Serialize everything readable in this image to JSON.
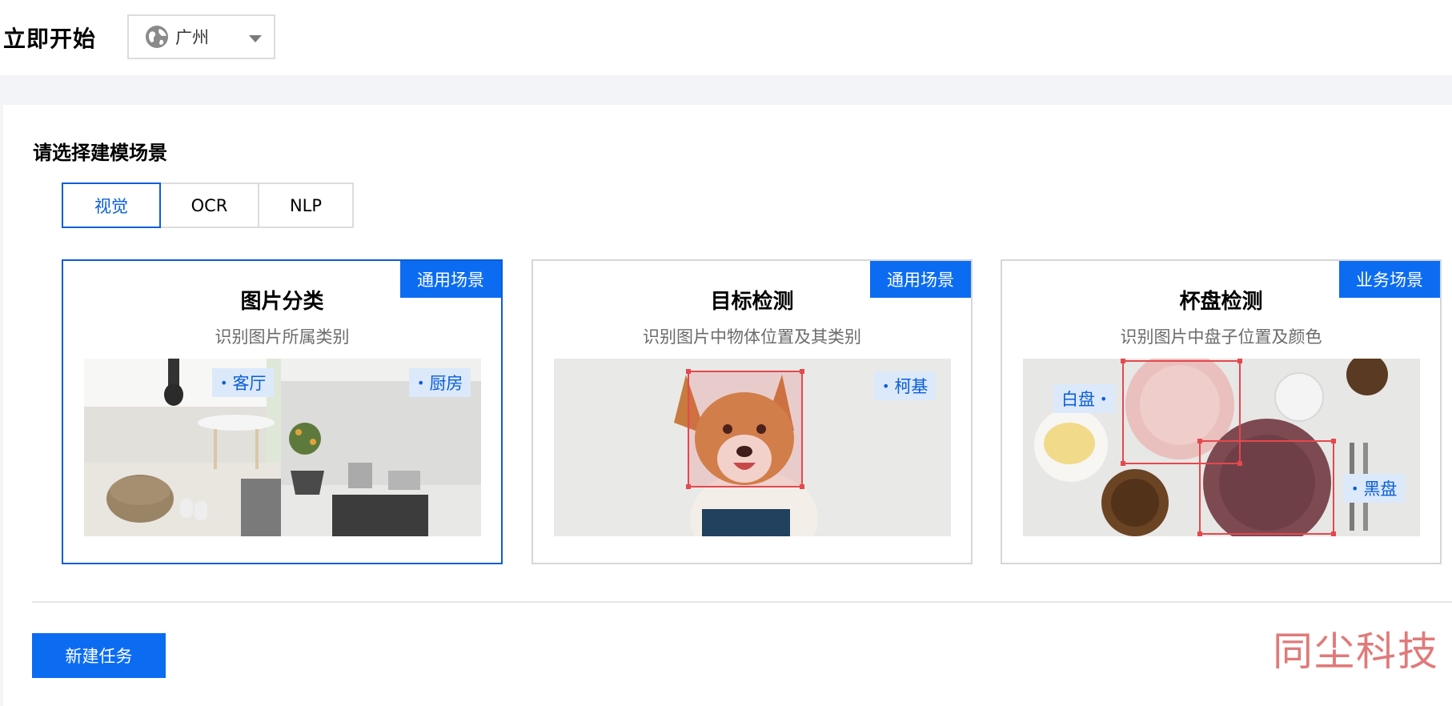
{
  "header": {
    "title": "立即开始",
    "region_select": {
      "value": "广州",
      "icon": "globe-icon"
    }
  },
  "main": {
    "section_title": "请选择建模场景",
    "tabs": [
      {
        "label": "视觉",
        "active": true
      },
      {
        "label": "OCR",
        "active": false
      },
      {
        "label": "NLP",
        "active": false
      }
    ],
    "cards": [
      {
        "title": "图片分类",
        "description": "识别图片所属类别",
        "tag": "通用场景",
        "selected": true,
        "labels": [
          "客厅",
          "厨房"
        ]
      },
      {
        "title": "目标检测",
        "description": "识别图片中物体位置及其类别",
        "tag": "通用场景",
        "selected": false,
        "labels": [
          "柯基"
        ]
      },
      {
        "title": "杯盘检测",
        "description": "识别图片中盘子位置及颜色",
        "tag": "业务场景",
        "selected": false,
        "labels": [
          "白盘",
          "黑盘"
        ]
      }
    ],
    "create_button": "新建任务"
  },
  "watermark": "同尘科技",
  "colors": {
    "accent": "#0b6cf2",
    "detection_box": "#e5484d",
    "tag_bg": "#dbe9fb"
  }
}
